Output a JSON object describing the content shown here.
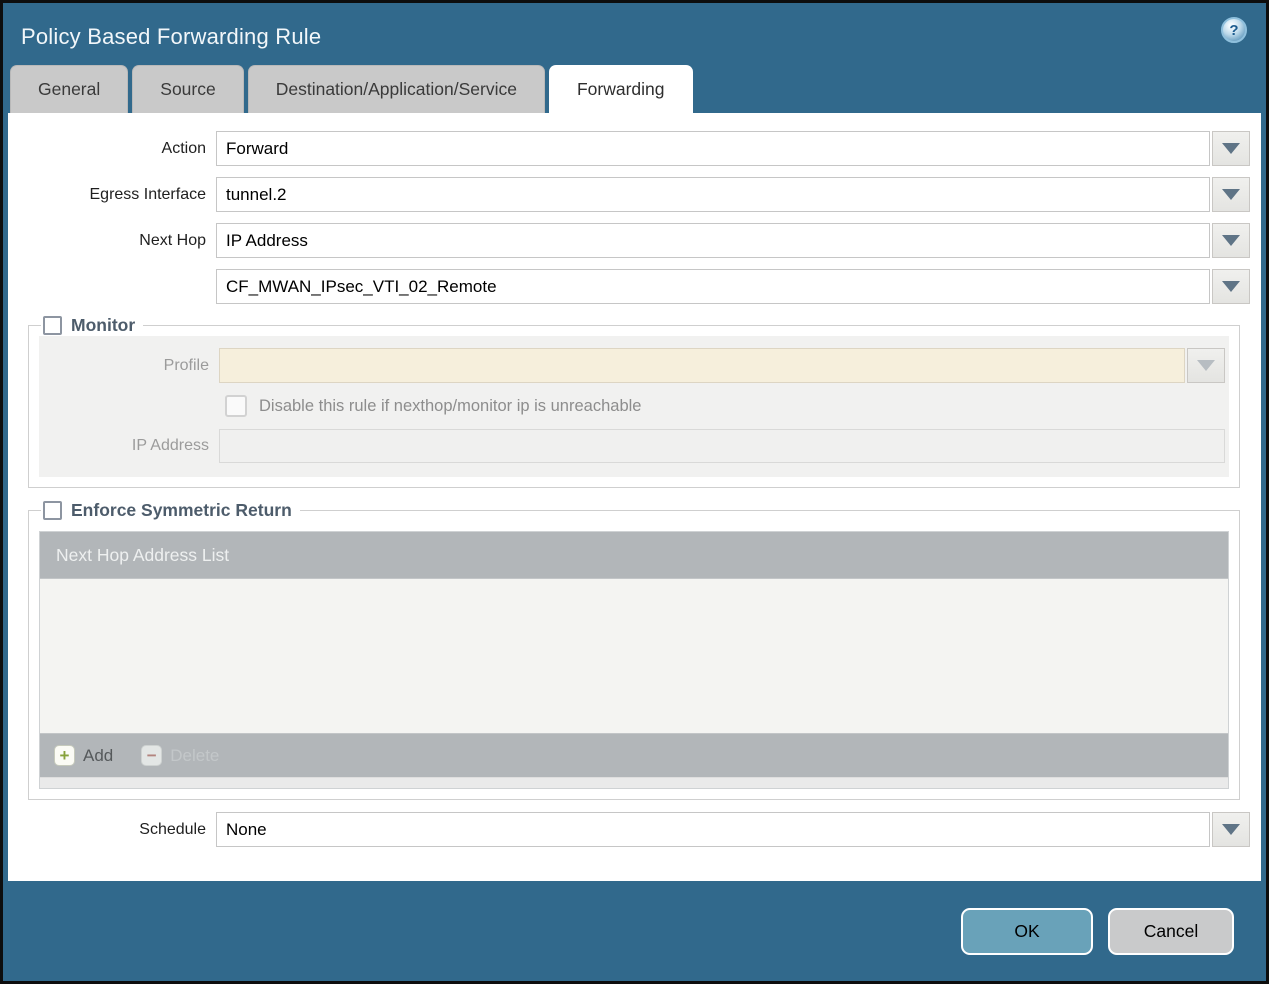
{
  "dialog": {
    "title": "Policy Based Forwarding Rule"
  },
  "icons": {
    "help_glyph": "?",
    "plus_glyph": "+",
    "minus_glyph": "−"
  },
  "tabs": [
    {
      "label": "General",
      "active": false
    },
    {
      "label": "Source",
      "active": false
    },
    {
      "label": "Destination/Application/Service",
      "active": false
    },
    {
      "label": "Forwarding",
      "active": true
    }
  ],
  "form": {
    "action": {
      "label": "Action",
      "value": "Forward"
    },
    "egress_interface": {
      "label": "Egress Interface",
      "value": "tunnel.2"
    },
    "next_hop": {
      "label": "Next Hop",
      "value": "IP Address"
    },
    "next_hop_address": {
      "value": "CF_MWAN_IPsec_VTI_02_Remote"
    },
    "schedule": {
      "label": "Schedule",
      "value": "None"
    }
  },
  "monitor": {
    "legend": "Monitor",
    "checked": false,
    "profile": {
      "label": "Profile",
      "value": ""
    },
    "disable_rule_label": "Disable this rule if nexthop/monitor ip is unreachable",
    "disable_rule_checked": false,
    "ip_address": {
      "label": "IP Address",
      "value": ""
    }
  },
  "enforce": {
    "legend": "Enforce Symmetric Return",
    "checked": false,
    "table_header": "Next Hop Address List",
    "rows": [],
    "add_label": "Add",
    "delete_label": "Delete"
  },
  "buttons": {
    "ok": "OK",
    "cancel": "Cancel"
  },
  "colors": {
    "teal": "#31698c",
    "ok": "#69a2b9",
    "grid_header": "#b2b6b9",
    "legend_text": "#4d5c6b"
  }
}
